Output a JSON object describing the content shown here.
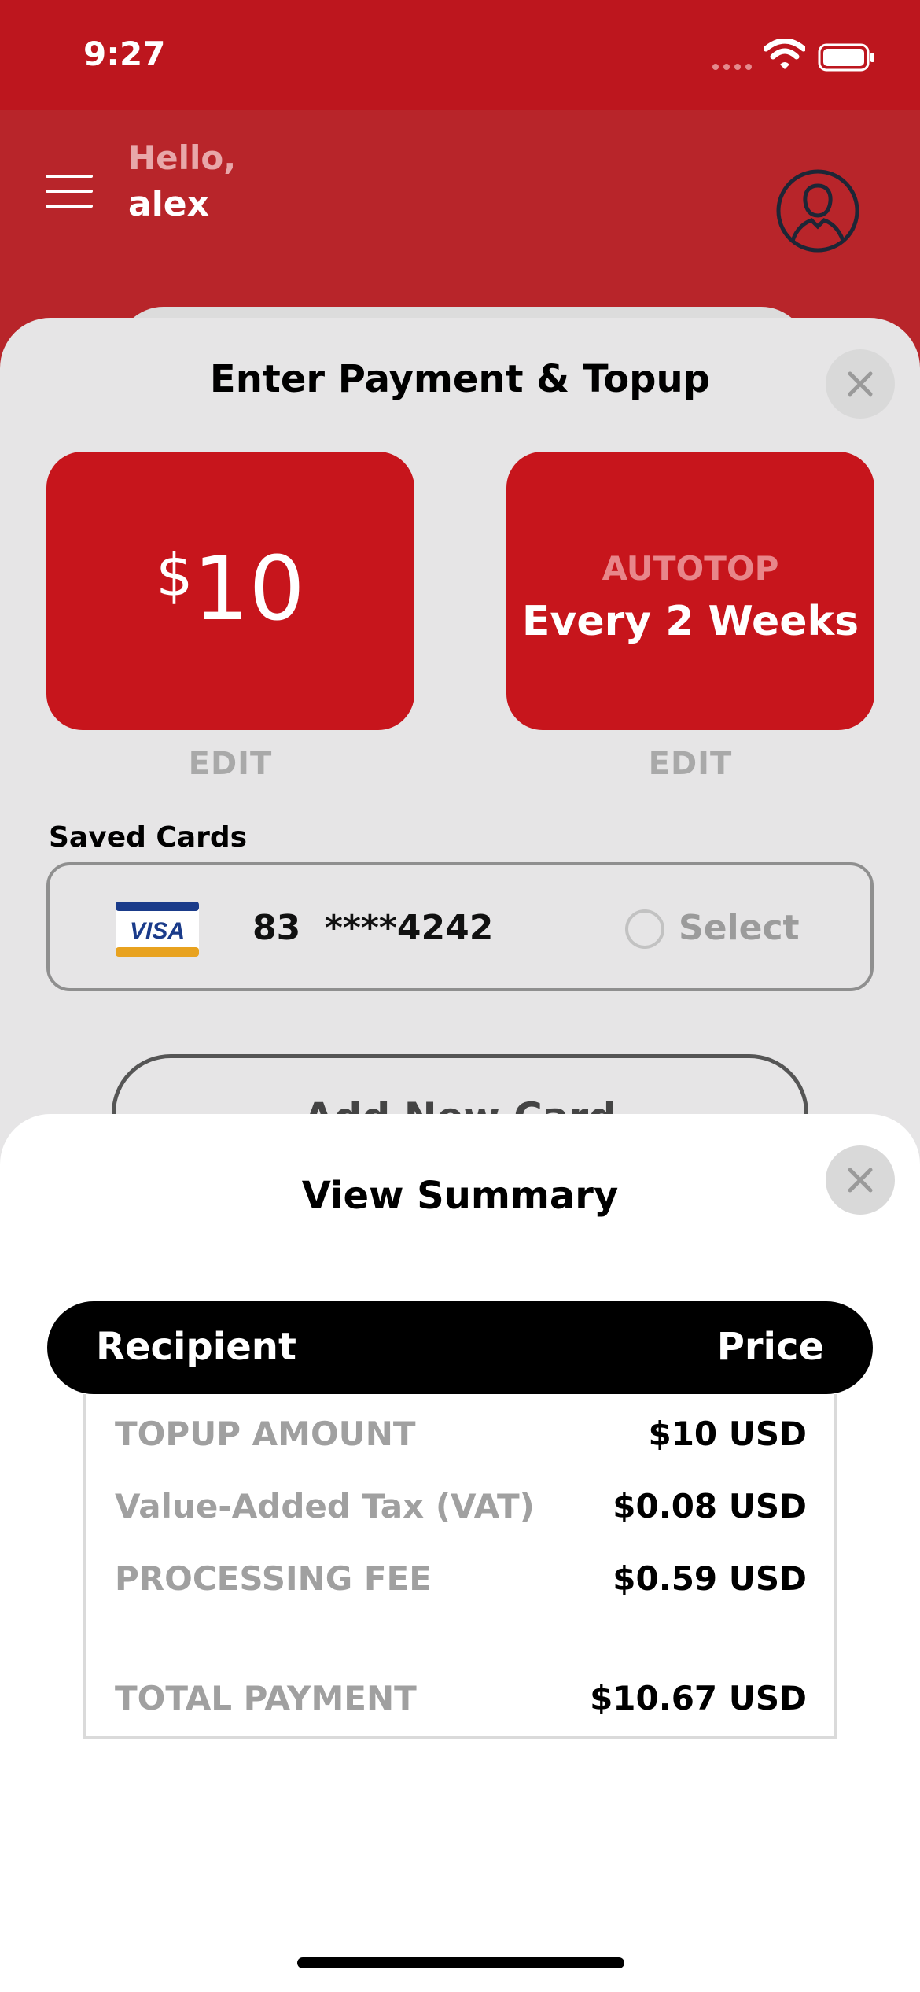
{
  "status_bar": {
    "time": "9:27"
  },
  "header": {
    "greeting": "Hello,",
    "user_name": "alex"
  },
  "payment_sheet": {
    "title": "Enter Payment & Topup",
    "amount_tile": {
      "currency": "$",
      "amount": "10",
      "edit_label": "EDIT"
    },
    "autotop_tile": {
      "label": "AUTOTOP",
      "frequency": "Every 2 Weeks",
      "edit_label": "EDIT"
    },
    "saved_cards_label": "Saved Cards",
    "card": {
      "brand_icon": "visa-icon",
      "number": "83  ****4242",
      "select_label": "Select"
    },
    "add_card_label": "Add New Card"
  },
  "summary_sheet": {
    "title": "View Summary",
    "head_left": "Recipient",
    "head_right": "Price",
    "rows": [
      {
        "label": "TOPUP AMOUNT",
        "value": "$10 USD"
      },
      {
        "label": "Value-Added Tax (VAT)",
        "value": "$0.08 USD"
      },
      {
        "label": "PROCESSING FEE",
        "value": "$0.59 USD"
      },
      {
        "label": "TOTAL PAYMENT",
        "value": "$10.67 USD"
      }
    ]
  },
  "colors": {
    "brand_red": "#bd161e",
    "tile_red": "#c7151c",
    "sheet_gray": "#e6e5e6"
  }
}
